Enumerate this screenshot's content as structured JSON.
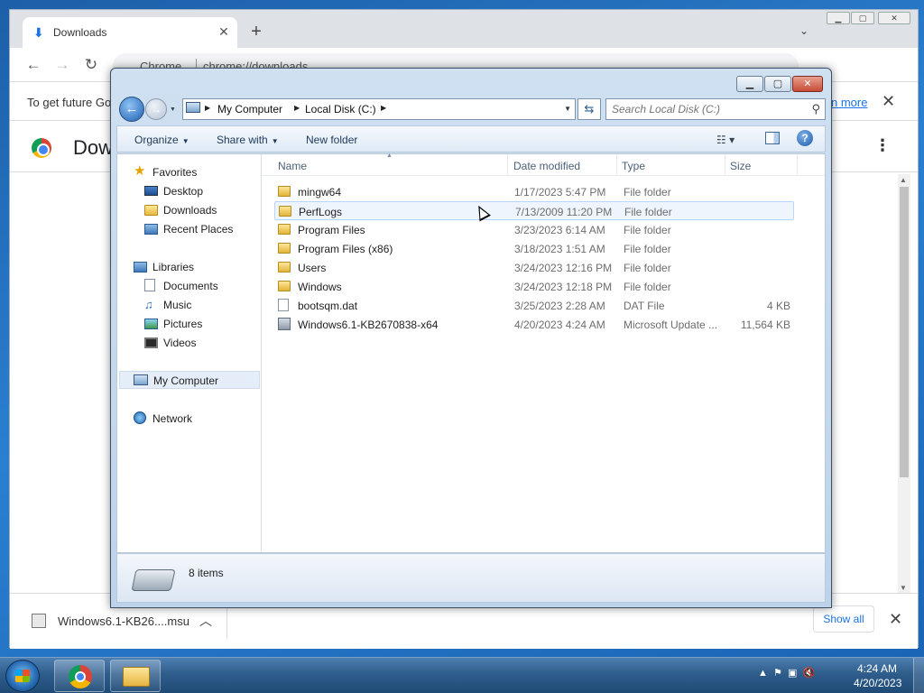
{
  "chrome": {
    "tab_title": "Downloads",
    "omnibox_origin": "Chrome",
    "omnibox_url": "chrome://downloads",
    "infobar_text": "To get future Go",
    "infobar_link": "n more",
    "page_title": "Dow",
    "download_file": "Windows6.1-KB26....msu",
    "show_all": "Show all"
  },
  "explorer": {
    "breadcrumb": [
      "My Computer",
      "Local Disk (C:)"
    ],
    "search_placeholder": "Search Local Disk (C:)",
    "commands": {
      "organize": "Organize",
      "share": "Share with",
      "new_folder": "New folder"
    },
    "nav": {
      "favorites": "Favorites",
      "desktop": "Desktop",
      "downloads": "Downloads",
      "recent": "Recent Places",
      "libraries": "Libraries",
      "documents": "Documents",
      "music": "Music",
      "pictures": "Pictures",
      "videos": "Videos",
      "computer": "My Computer",
      "network": "Network"
    },
    "columns": {
      "name": "Name",
      "date": "Date modified",
      "type": "Type",
      "size": "Size"
    },
    "files": [
      {
        "name": "mingw64",
        "date": "1/17/2023 5:47 PM",
        "type": "File folder",
        "size": ""
      },
      {
        "name": "PerfLogs",
        "date": "7/13/2009 11:20 PM",
        "type": "File folder",
        "size": ""
      },
      {
        "name": "Program Files",
        "date": "3/23/2023 6:14 AM",
        "type": "File folder",
        "size": ""
      },
      {
        "name": "Program Files (x86)",
        "date": "3/18/2023 1:51 AM",
        "type": "File folder",
        "size": ""
      },
      {
        "name": "Users",
        "date": "3/24/2023 12:16 PM",
        "type": "File folder",
        "size": ""
      },
      {
        "name": "Windows",
        "date": "3/24/2023 12:18 PM",
        "type": "File folder",
        "size": ""
      },
      {
        "name": "bootsqm.dat",
        "date": "3/25/2023 2:28 AM",
        "type": "DAT File",
        "size": "4 KB"
      },
      {
        "name": "Windows6.1-KB2670838-x64",
        "date": "4/20/2023 4:24 AM",
        "type": "Microsoft Update ...",
        "size": "11,564 KB"
      }
    ],
    "item_count": "8 items"
  },
  "taskbar": {
    "time": "4:24 AM",
    "date": "4/20/2023"
  }
}
